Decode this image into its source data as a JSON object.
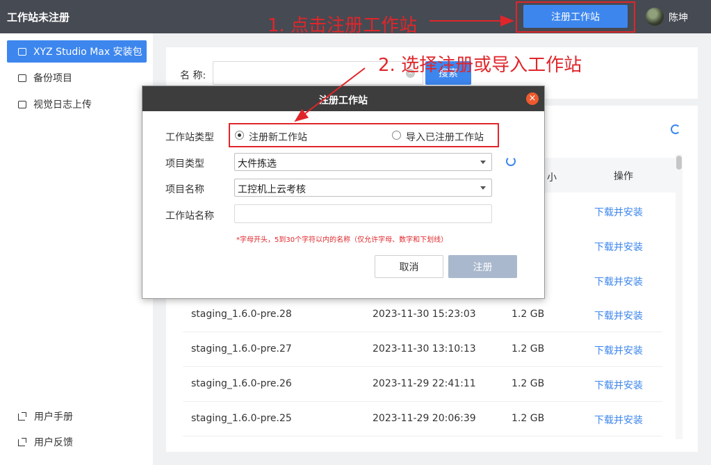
{
  "header": {
    "app_title": "工作站未注册",
    "register_button": "注册工作站",
    "username": "陈坤"
  },
  "sidebar": {
    "items": [
      {
        "label": "XYZ Studio Max 安装包",
        "icon": "package-icon",
        "active": true
      },
      {
        "label": "备份项目",
        "icon": "backup-icon",
        "active": false
      },
      {
        "label": "视觉日志上传",
        "icon": "image-icon",
        "active": false
      }
    ],
    "bottom": [
      {
        "label": "用户手册",
        "icon": "external-link-icon"
      },
      {
        "label": "用户反馈",
        "icon": "external-link-icon"
      }
    ]
  },
  "search": {
    "label": "名 称:",
    "value": "",
    "button": "搜索"
  },
  "table": {
    "headers": {
      "size_partial": "小",
      "operation": "操作"
    },
    "partial_rows_op": [
      "下载并安装",
      "下载并安装",
      "下载并安装"
    ],
    "rows": [
      {
        "name": "staging_1.6.0-pre.28",
        "date": "2023-11-30 15:23:03",
        "size": "1.2 GB",
        "op": "下载并安装"
      },
      {
        "name": "staging_1.6.0-pre.27",
        "date": "2023-11-30 13:10:13",
        "size": "1.2 GB",
        "op": "下载并安装"
      },
      {
        "name": "staging_1.6.0-pre.26",
        "date": "2023-11-29 22:41:11",
        "size": "1.2 GB",
        "op": "下载并安装"
      },
      {
        "name": "staging_1.6.0-pre.25",
        "date": "2023-11-29 20:06:39",
        "size": "1.2 GB",
        "op": "下载并安装"
      }
    ]
  },
  "modal": {
    "title": "注册工作站",
    "close": "×",
    "type_label": "工作站类型",
    "type_options": [
      "注册新工作站",
      "导入已注册工作站"
    ],
    "project_type_label": "项目类型",
    "project_type_value": "大件拣选",
    "project_name_label": "项目名称",
    "project_name_value": "工控机上云考核",
    "station_name_label": "工作站名称",
    "station_name_value": "",
    "hint": "*字母开头，5到30个字符以内的名称（仅允许字母、数字和下划线）",
    "cancel": "取消",
    "submit": "注册"
  },
  "annotations": {
    "step1": "1. 点击注册工作站",
    "step2": "2. 选择注册或导入工作站"
  },
  "colors": {
    "header_bg": "#464a52",
    "accent": "#3d86ee",
    "annotation": "#e0262b",
    "disabled_button": "#a9b8cd"
  }
}
